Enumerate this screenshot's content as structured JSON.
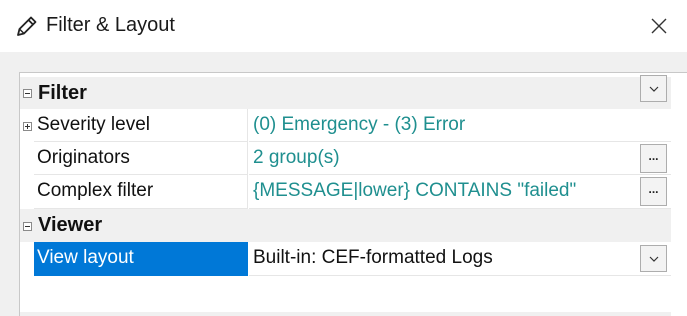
{
  "window": {
    "title": "Filter & Layout"
  },
  "categories": {
    "filter": {
      "label": "Filter"
    },
    "viewer": {
      "label": "Viewer"
    }
  },
  "properties": {
    "severity": {
      "name": "Severity level",
      "value": "(0) Emergency - (3) Error"
    },
    "originators": {
      "name": "Originators",
      "value": "2 group(s)",
      "button_label": "..."
    },
    "complex_filter": {
      "name": "Complex filter",
      "value": "{MESSAGE|lower} CONTAINS \"failed\"",
      "button_label": "..."
    },
    "view_layout": {
      "name": "View layout",
      "value": "Built-in: CEF-formatted Logs"
    }
  },
  "colors": {
    "accent_selection": "#0078d7",
    "value_text": "#1f8f8f"
  },
  "icons": {
    "title": "pencil-icon",
    "close": "close-icon",
    "collapse": "minus-icon",
    "expand": "plus-icon",
    "dropdown": "chevron-down-icon"
  }
}
